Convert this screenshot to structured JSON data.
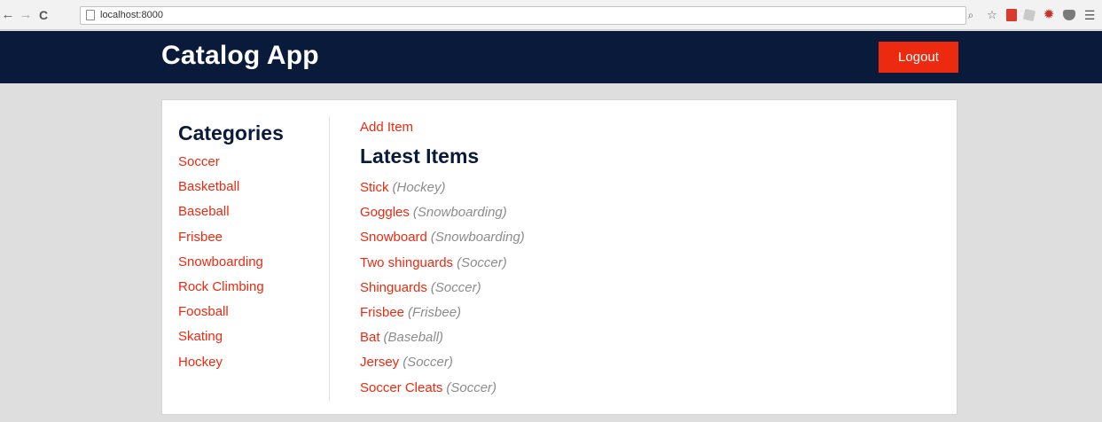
{
  "browser": {
    "address": "localhost:8000"
  },
  "header": {
    "title": "Catalog App",
    "logout_label": "Logout"
  },
  "sidebar": {
    "heading": "Categories",
    "categories": [
      "Soccer",
      "Basketball",
      "Baseball",
      "Frisbee",
      "Snowboarding",
      "Rock Climbing",
      "Foosball",
      "Skating",
      "Hockey"
    ]
  },
  "main": {
    "add_item_label": "Add Item",
    "heading": "Latest Items",
    "items": [
      {
        "name": "Stick",
        "category": "(Hockey)"
      },
      {
        "name": "Goggles",
        "category": "(Snowboarding)"
      },
      {
        "name": "Snowboard",
        "category": "(Snowboarding)"
      },
      {
        "name": "Two shinguards",
        "category": "(Soccer)"
      },
      {
        "name": "Shinguards",
        "category": "(Soccer)"
      },
      {
        "name": "Frisbee",
        "category": "(Frisbee)"
      },
      {
        "name": "Bat",
        "category": "(Baseball)"
      },
      {
        "name": "Jersey",
        "category": "(Soccer)"
      },
      {
        "name": "Soccer Cleats",
        "category": "(Soccer)"
      }
    ]
  },
  "colors": {
    "header_bg": "#0a1a3b",
    "accent": "#ec2a10",
    "muted": "#8c8c8c",
    "page_bg": "#dedede"
  }
}
